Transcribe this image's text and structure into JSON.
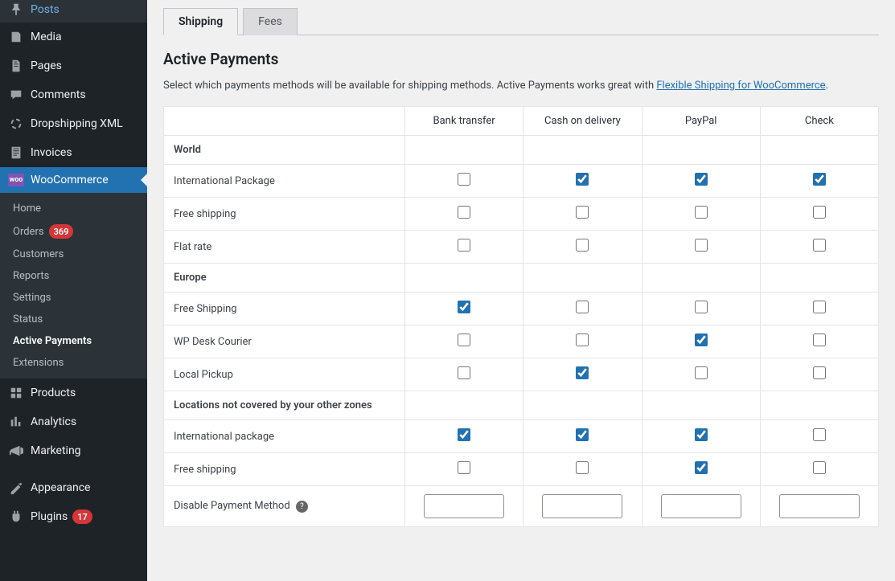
{
  "sidebar": {
    "items": [
      {
        "label": "Posts",
        "icon": "pin"
      },
      {
        "label": "Media",
        "icon": "media"
      },
      {
        "label": "Pages",
        "icon": "page"
      },
      {
        "label": "Comments",
        "icon": "comment"
      },
      {
        "label": "Dropshipping XML",
        "icon": "refresh"
      },
      {
        "label": "Invoices",
        "icon": "invoice"
      },
      {
        "label": "WooCommerce",
        "icon": "woo",
        "active": true
      },
      {
        "label": "Products",
        "icon": "products"
      },
      {
        "label": "Analytics",
        "icon": "analytics"
      },
      {
        "label": "Marketing",
        "icon": "marketing"
      },
      {
        "label": "Appearance",
        "icon": "appearance"
      },
      {
        "label": "Plugins",
        "icon": "plugins",
        "badge": "17"
      }
    ],
    "submenu": [
      {
        "label": "Home"
      },
      {
        "label": "Orders",
        "badge": "369"
      },
      {
        "label": "Customers"
      },
      {
        "label": "Reports"
      },
      {
        "label": "Settings"
      },
      {
        "label": "Status"
      },
      {
        "label": "Active Payments",
        "current": true
      },
      {
        "label": "Extensions"
      }
    ]
  },
  "tabs": [
    {
      "label": "Shipping",
      "active": true
    },
    {
      "label": "Fees"
    }
  ],
  "page_title": "Active Payments",
  "description_prefix": "Select which payments methods will be available for shipping methods. Active Payments works great with ",
  "description_link_text": "Flexible Shipping for WooCommerce",
  "description_suffix": ".",
  "table": {
    "headers": [
      "",
      "Bank transfer",
      "Cash on delivery",
      "PayPal",
      "Check"
    ],
    "sections": [
      {
        "zone": "World",
        "rows": [
          {
            "label": "International Package",
            "cells": [
              false,
              true,
              true,
              true
            ]
          },
          {
            "label": "Free shipping",
            "cells": [
              false,
              false,
              false,
              false
            ]
          },
          {
            "label": "Flat rate",
            "cells": [
              false,
              false,
              false,
              false
            ]
          }
        ]
      },
      {
        "zone": "Europe",
        "rows": [
          {
            "label": "Free Shipping",
            "cells": [
              true,
              false,
              false,
              false
            ]
          },
          {
            "label": "WP Desk Courier",
            "cells": [
              false,
              false,
              true,
              false
            ]
          },
          {
            "label": "Local Pickup",
            "cells": [
              false,
              true,
              false,
              false
            ]
          }
        ]
      },
      {
        "zone": "Locations not covered by your other zones",
        "rows": [
          {
            "label": "International package",
            "cells": [
              true,
              true,
              true,
              false
            ]
          },
          {
            "label": "Free shipping",
            "cells": [
              false,
              false,
              true,
              false
            ]
          }
        ]
      }
    ],
    "disable_row_label": "Disable Payment Method"
  }
}
